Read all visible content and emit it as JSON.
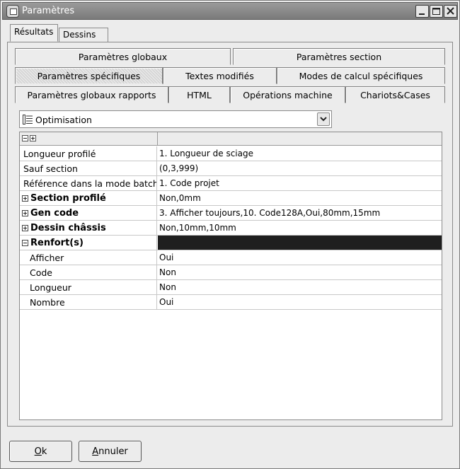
{
  "window": {
    "title": "Paramètres"
  },
  "tabs": [
    {
      "label": "Résultats",
      "active": true
    },
    {
      "label": "Dessins",
      "active": false
    }
  ],
  "subtabs": {
    "row1": [
      "Paramètres globaux",
      "Paramètres section"
    ],
    "row2": [
      "Paramètres spécifiques",
      "Textes modifiés",
      "Modes de calcul spécifiques"
    ],
    "row3": [
      "Paramètres globaux rapports",
      "HTML",
      "Opérations machine",
      "Chariots&Cases"
    ],
    "active": "Paramètres spécifiques"
  },
  "combo": {
    "value": "Optimisation",
    "icon": "list-tree-icon"
  },
  "grid": {
    "rows": [
      {
        "name": "Longueur profilé",
        "value": "1. Longueur de sciage"
      },
      {
        "name": "Sauf section",
        "value": "(0,3,999)"
      },
      {
        "name": "Référence dans la mode batch",
        "value": "1. Code projet"
      },
      {
        "name": "Section profilé",
        "value": "Non,0mm"
      },
      {
        "name": "Gen code",
        "value": "3. Afficher toujours,10. Code128A,Oui,80mm,15mm"
      },
      {
        "name": "Dessin châssis",
        "value": "Non,10mm,10mm"
      },
      {
        "name": "Renfort(s)",
        "value": ""
      },
      {
        "name": "Afficher",
        "value": "Oui"
      },
      {
        "name": "Code",
        "value": "Non"
      },
      {
        "name": "Longueur",
        "value": "Non"
      },
      {
        "name": "Nombre",
        "value": "Oui"
      }
    ]
  },
  "buttons": {
    "ok_mnemonic": "O",
    "ok_rest": "k",
    "cancel_mnemonic": "A",
    "cancel_rest": "nnuler"
  },
  "colors": {
    "titlebar": "#8a8a8a",
    "selected_value_bg": "#1f1f1f"
  }
}
